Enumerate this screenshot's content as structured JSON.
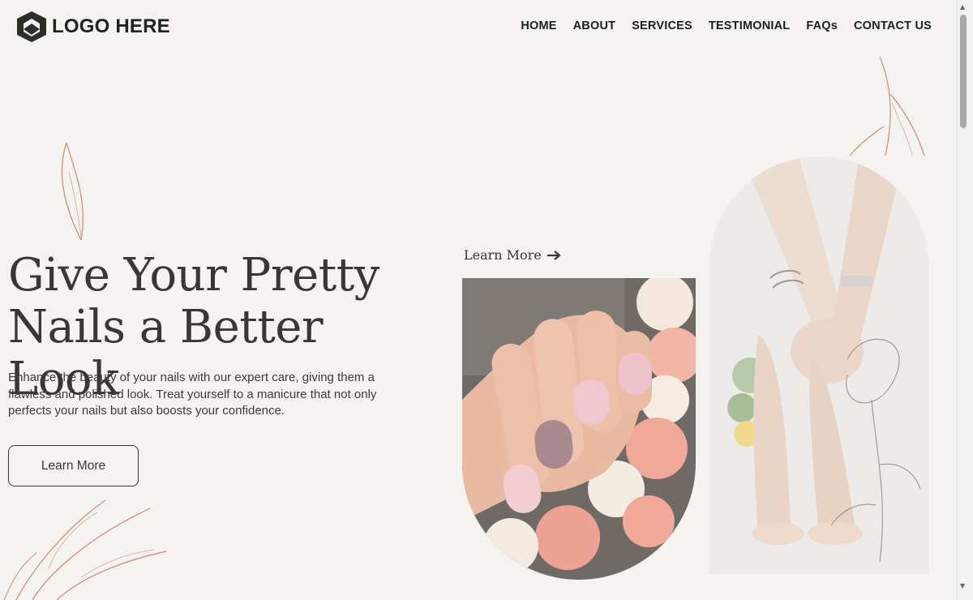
{
  "brand": {
    "logo_text": "LOGO HERE",
    "accent": "#c98a72",
    "text_color": "#3a3631",
    "background": "#f5f3ef"
  },
  "nav": {
    "items": [
      {
        "label": "HOME"
      },
      {
        "label": "ABOUT"
      },
      {
        "label": "SERVICES"
      },
      {
        "label": "TESTIMONIAL"
      },
      {
        "label": "FAQs"
      },
      {
        "label": "CONTACT US"
      }
    ]
  },
  "hero": {
    "title_line1": "Give Your Pretty",
    "title_line2": "Nails a Better Look",
    "description": "Enhance the beauty of your nails with our expert care, giving them a flawless and polished look. Treat yourself to a manicure that not only perfects your nails but also boosts your confidence.",
    "button_label": "Learn More",
    "link_label": "Learn More",
    "link_icon": "arrow-right-icon"
  },
  "images": {
    "manicure": "hand-with-pink-nails-and-roses",
    "pedicure": "feet-and-hands-pedicure"
  }
}
